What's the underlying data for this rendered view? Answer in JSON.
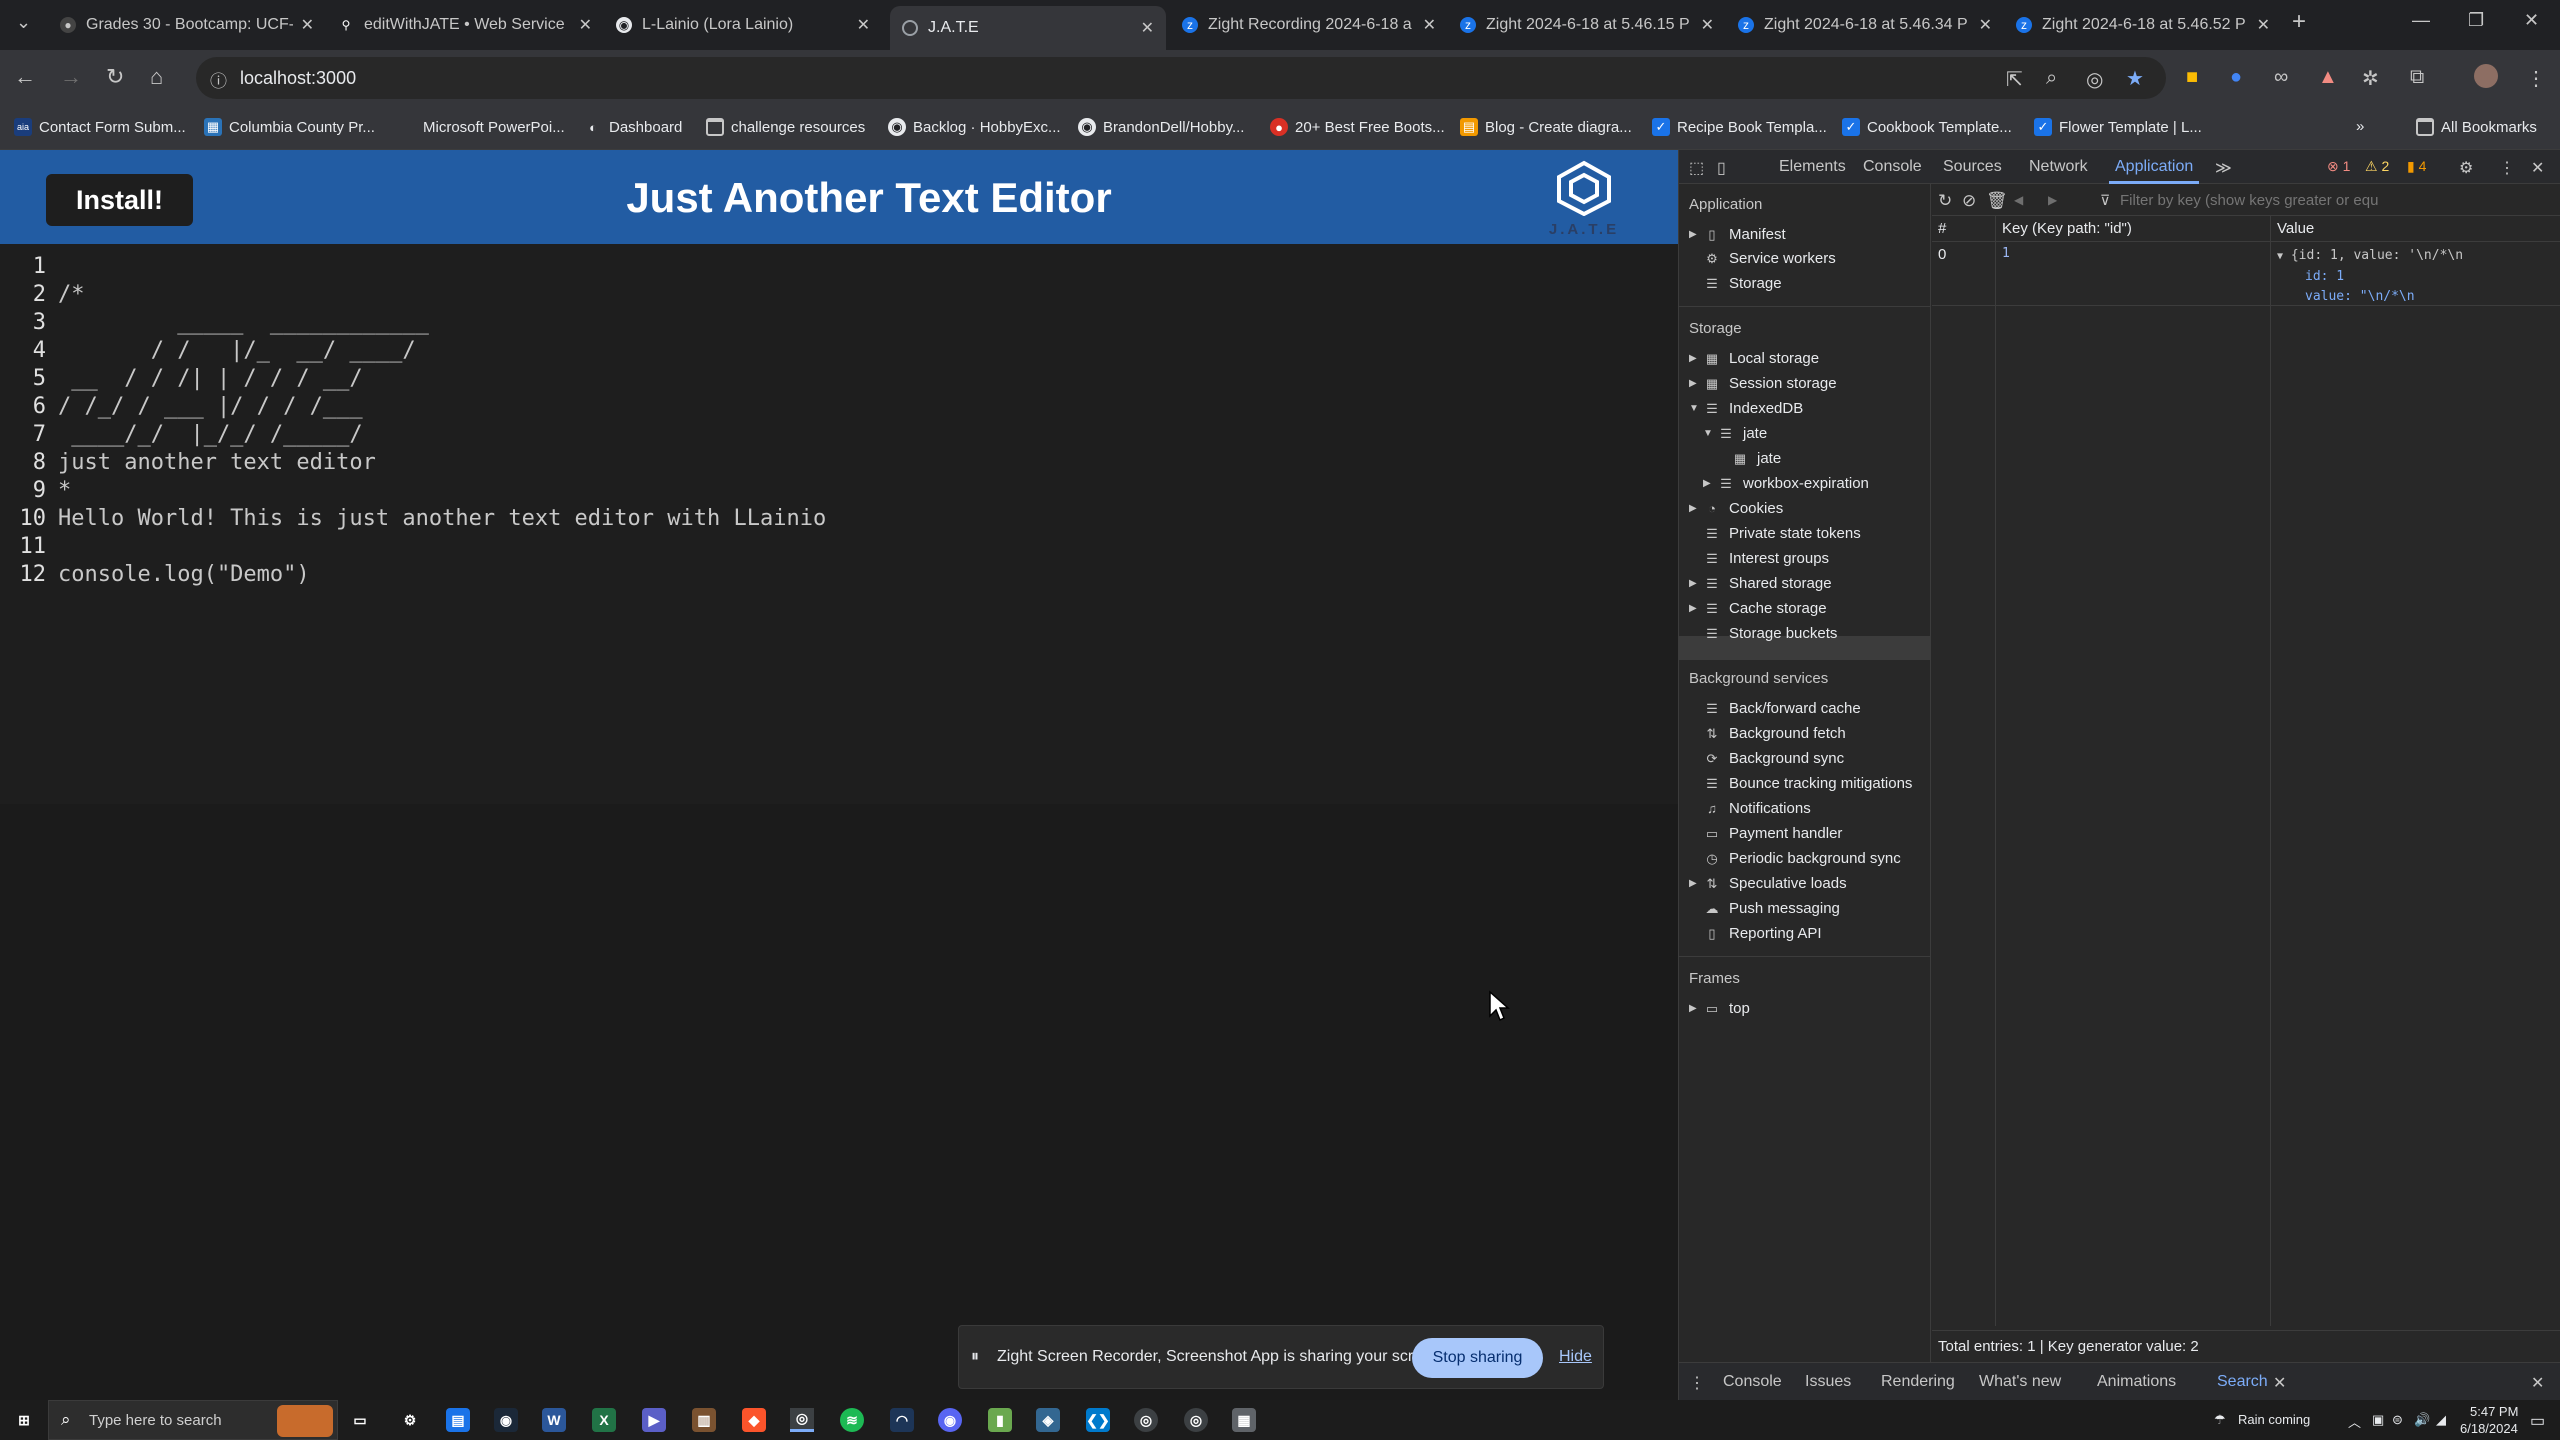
{
  "browser": {
    "tabs": [
      {
        "title": "Grades 30 - Bootcamp: UCF-",
        "icon": "canvas-icon",
        "active": false
      },
      {
        "title": "editWithJATE • Web Service",
        "icon": "render-icon",
        "active": false
      },
      {
        "title": "L-Lainio (Lora Lainio)",
        "icon": "github-icon",
        "active": false
      },
      {
        "title": "J.A.T.E",
        "icon": "globe-icon",
        "active": true
      },
      {
        "title": "Zight Recording 2024-6-18 a",
        "icon": "zight-icon",
        "active": false
      },
      {
        "title": "Zight 2024-6-18 at 5.46.15 P",
        "icon": "zight-icon",
        "active": false
      },
      {
        "title": "Zight 2024-6-18 at 5.46.34 P",
        "icon": "zight-icon",
        "active": false
      },
      {
        "title": "Zight 2024-6-18 at 5.46.52 P",
        "icon": "zight-icon",
        "active": false
      }
    ],
    "url": "localhost:3000",
    "bookmarks": [
      {
        "label": "Contact Form Subm..."
      },
      {
        "label": "Columbia County Pr..."
      },
      {
        "label": "Microsoft PowerPoi..."
      },
      {
        "label": "Dashboard"
      },
      {
        "label": "challenge resources"
      },
      {
        "label": "Backlog · HobbyExc..."
      },
      {
        "label": "BrandonDell/Hobby..."
      },
      {
        "label": "20+ Best Free Boots..."
      },
      {
        "label": "Blog - Create diagra..."
      },
      {
        "label": "Recipe Book Templa..."
      },
      {
        "label": "Cookbook Template..."
      },
      {
        "label": "Flower Template | L..."
      }
    ],
    "all_bookmarks": "All Bookmarks"
  },
  "app": {
    "install_label": "Install!",
    "title": "Just Another Text Editor",
    "logo_text": "J.A.T.E",
    "lines": [
      {
        "n": "1",
        "text": ""
      },
      {
        "n": "2",
        "text": "/*"
      },
      {
        "n": "3",
        "text": "         _____  ____________"
      },
      {
        "n": "4",
        "text": "       / /   |/_  __/ ____/"
      },
      {
        "n": "5",
        "text": " __  / / /| | / / / __/"
      },
      {
        "n": "6",
        "text": "/ /_/ / ___ |/ / / /___"
      },
      {
        "n": "7",
        "text": " ____/_/  |_/_/ /_____/"
      },
      {
        "n": "8",
        "text": "just another text editor"
      },
      {
        "n": "9",
        "text": "*"
      },
      {
        "n": "10",
        "text": "Hello World! This is just another text editor with LLainio"
      },
      {
        "n": "11",
        "text": ""
      },
      {
        "n": "12",
        "text": "console.log(\"Demo\")"
      }
    ]
  },
  "share": {
    "message": "Zight Screen Recorder, Screenshot App is sharing your screen.",
    "stop_label": "Stop sharing",
    "hide_label": "Hide"
  },
  "devtools": {
    "tabs": [
      "Elements",
      "Console",
      "Sources",
      "Network",
      "Application"
    ],
    "errors": "1",
    "warnings": "2",
    "issues": "4",
    "sidebar": {
      "application_header": "Application",
      "application_items": [
        "Manifest",
        "Service workers",
        "Storage"
      ],
      "storage_header": "Storage",
      "storage_items": [
        "Local storage",
        "Session storage",
        "IndexedDB",
        "jate",
        "jate",
        "workbox-expiration",
        "Cookies",
        "Private state tokens",
        "Interest groups",
        "Shared storage",
        "Cache storage",
        "Storage buckets"
      ],
      "background_header": "Background services",
      "background_items": [
        "Back/forward cache",
        "Background fetch",
        "Background sync",
        "Bounce tracking mitigations",
        "Notifications",
        "Payment handler",
        "Periodic background sync",
        "Speculative loads",
        "Push messaging",
        "Reporting API"
      ],
      "frames_header": "Frames",
      "frames_items": [
        "top"
      ]
    },
    "filter_placeholder": "Filter by key (show keys greater or equ",
    "table": {
      "headers": [
        "#",
        "Key (Key path: \"id\")",
        "Value"
      ],
      "row": {
        "index": "0",
        "key": "1",
        "value_summary": "{id: 1, value: '\\n/*\\n",
        "value_id": "id: 1",
        "value_value": "value: \"\\n/*\\n"
      }
    },
    "summary": "Total entries: 1  |  Key generator value: 2",
    "drawer_tabs": [
      "Console",
      "Issues",
      "Rendering",
      "What's new",
      "Animations",
      "Search"
    ]
  },
  "taskbar": {
    "search_placeholder": "Type here to search",
    "weather": "Rain coming",
    "time": "5:47 PM",
    "date": "6/18/2024"
  }
}
